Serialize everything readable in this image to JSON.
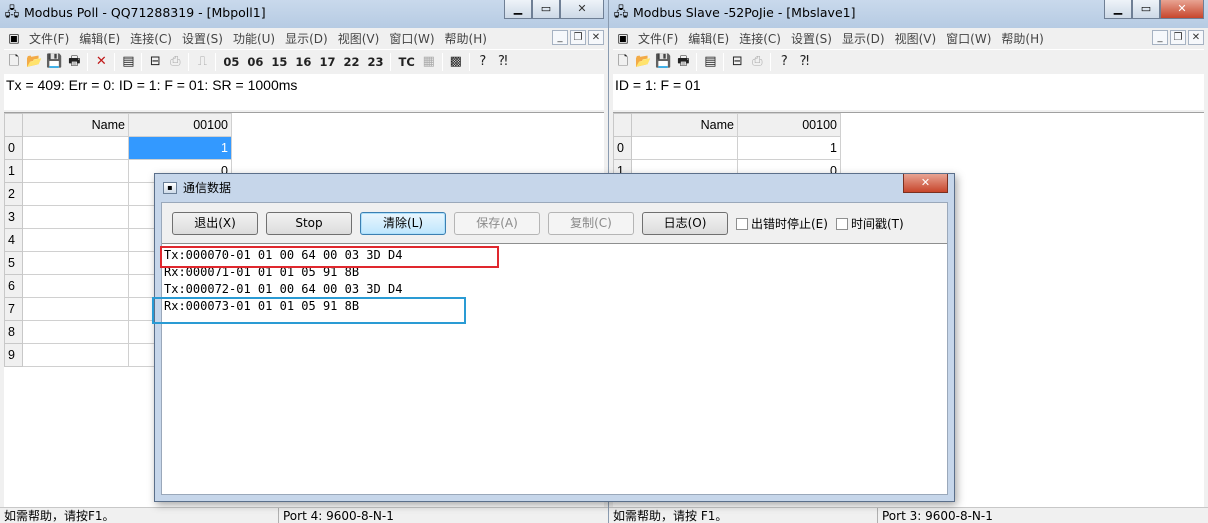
{
  "poll": {
    "title": "Modbus Poll - QQ71288319 - [Mbpoll1]",
    "app_icon": "network-icon",
    "menu": [
      "文件(F)",
      "编辑(E)",
      "连接(C)",
      "设置(S)",
      "功能(U)",
      "显示(D)",
      "视图(V)",
      "窗口(W)",
      "帮助(H)"
    ],
    "function_buttons": [
      "05",
      "06",
      "15",
      "16",
      "17",
      "22",
      "23"
    ],
    "tc_label": "TC",
    "status_line": "Tx = 409: Err = 0: ID = 1: F = 01: SR = 1000ms",
    "grid": {
      "name_header": "Name",
      "value_header": "00100",
      "rows": [
        "0",
        "1",
        "2",
        "3",
        "4",
        "5",
        "6",
        "7",
        "8",
        "9"
      ],
      "values": [
        "1",
        "0",
        "",
        "",
        "",
        "",
        "",
        "",
        "",
        ""
      ]
    },
    "statusbar": {
      "help": "如需帮助，请按F1。",
      "port": "Port 4: 9600-8-N-1"
    }
  },
  "slave": {
    "title": "Modbus Slave -52PoJie - [Mbslave1]",
    "app_icon": "network-icon",
    "menu": [
      "文件(F)",
      "编辑(E)",
      "连接(C)",
      "设置(S)",
      "显示(D)",
      "视图(V)",
      "窗口(W)",
      "帮助(H)"
    ],
    "status_line": "ID = 1: F = 01",
    "grid": {
      "name_header": "Name",
      "value_header": "00100",
      "rows": [
        "0",
        "1"
      ],
      "values": [
        "1",
        "0"
      ]
    },
    "statusbar": {
      "help": "如需帮助，请按 F1。",
      "port": "Port 3: 9600-8-N-1"
    }
  },
  "dialog": {
    "title": "通信数据",
    "buttons": {
      "exit": "退出(X)",
      "stop": "Stop",
      "clear": "清除(L)",
      "save": "保存(A)",
      "copy": "复制(C)",
      "log": "日志(O)"
    },
    "checkboxes": {
      "stop_on_error": "出错时停止(E)",
      "timestamp": "时间戳(T)"
    },
    "lines": [
      "Tx:000070-01 01 00 64 00 03 3D D4",
      "Rx:000071-01 01 01 05 91 8B",
      "Tx:000072-01 01 00 64 00 03 3D D4",
      "Rx:000073-01 01 01 05 91 8B"
    ],
    "highlight_colors": {
      "tx": "#e0282e",
      "rx": "#2a9bd4"
    }
  }
}
